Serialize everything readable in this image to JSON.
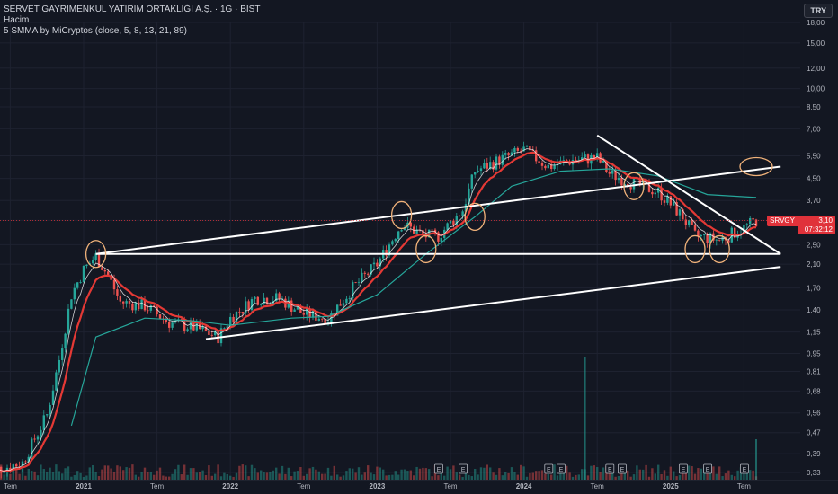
{
  "header": {
    "title": "SERVET GAYRİMENKUL YATIRIM ORTAKLIĞI A.Ş. · 1G · BIST",
    "volume_label": "Hacim",
    "indicator_label": "5 SMMA by MiCryptos (close, 5, 8, 13, 21, 89)",
    "currency_button": "TRY"
  },
  "price_tag": {
    "ticker": "SRVGY",
    "price": "3,10",
    "countdown": "07:32:12"
  },
  "colors": {
    "background": "#131722",
    "up": "#26a69a",
    "down": "#ef5350",
    "smma_fast": "#e53935",
    "smma_slow": "#26a69a",
    "trendline": "#ffffff",
    "circle": "#f0b27a",
    "price_tag": "#e0323a"
  },
  "chart_data": {
    "type": "candlestick",
    "scale": "log",
    "y_ticks": [
      "18,00",
      "15,00",
      "12,00",
      "10,00",
      "8,50",
      "7,00",
      "5,50",
      "4,50",
      "3,70",
      "3,10",
      "2,50",
      "2,10",
      "1,70",
      "1,40",
      "1,15",
      "0,95",
      "0,81",
      "0,68",
      "0,56",
      "0,47",
      "0,39",
      "0,33"
    ],
    "y_tick_values": [
      18,
      15,
      12,
      10,
      8.5,
      7,
      5.5,
      4.5,
      3.7,
      3.1,
      2.5,
      2.1,
      1.7,
      1.4,
      1.15,
      0.95,
      0.81,
      0.68,
      0.56,
      0.47,
      0.39,
      0.33
    ],
    "x_ticks": [
      "Tem",
      "2021",
      "Tem",
      "2022",
      "Tem",
      "2023",
      "Tem",
      "2024",
      "Tem",
      "2025",
      "Tem"
    ],
    "x_tick_dates": [
      "2020-07",
      "2021-01",
      "2021-07",
      "2022-01",
      "2022-07",
      "2023-01",
      "2023-07",
      "2024-01",
      "2024-07",
      "2025-01",
      "2025-07"
    ],
    "price_path": [
      [
        "2020-05",
        0.33
      ],
      [
        "2020-08",
        0.36
      ],
      [
        "2020-10",
        0.55
      ],
      [
        "2020-11",
        0.9
      ],
      [
        "2020-12",
        1.6
      ],
      [
        "2021-01",
        2.0
      ],
      [
        "2021-02",
        2.25
      ],
      [
        "2021-03",
        1.9
      ],
      [
        "2021-04",
        1.5
      ],
      [
        "2021-06",
        1.45
      ],
      [
        "2021-08",
        1.25
      ],
      [
        "2021-10",
        1.2
      ],
      [
        "2021-12",
        1.1
      ],
      [
        "2022-01",
        1.3
      ],
      [
        "2022-03",
        1.55
      ],
      [
        "2022-05",
        1.55
      ],
      [
        "2022-07",
        1.35
      ],
      [
        "2022-09",
        1.3
      ],
      [
        "2022-11",
        1.7
      ],
      [
        "2023-01",
        2.1
      ],
      [
        "2023-03",
        3.0
      ],
      [
        "2023-05",
        2.7
      ],
      [
        "2023-06",
        2.7
      ],
      [
        "2023-08",
        3.4
      ],
      [
        "2023-09",
        4.8
      ],
      [
        "2023-11",
        5.3
      ],
      [
        "2024-01",
        5.8
      ],
      [
        "2024-03",
        5.0
      ],
      [
        "2024-05",
        5.3
      ],
      [
        "2024-07",
        5.4
      ],
      [
        "2024-08",
        4.7
      ],
      [
        "2024-10",
        4.3
      ],
      [
        "2024-12",
        4.0
      ],
      [
        "2025-02",
        3.2
      ],
      [
        "2025-03",
        2.7
      ],
      [
        "2025-05",
        2.6
      ],
      [
        "2025-07",
        2.9
      ],
      [
        "2025-08",
        3.1
      ]
    ],
    "smma_slow_path": [
      [
        "2020-12",
        0.5
      ],
      [
        "2021-02",
        1.1
      ],
      [
        "2021-06",
        1.3
      ],
      [
        "2021-10",
        1.27
      ],
      [
        "2022-01",
        1.22
      ],
      [
        "2022-06",
        1.3
      ],
      [
        "2022-09",
        1.32
      ],
      [
        "2023-01",
        1.6
      ],
      [
        "2023-05",
        2.3
      ],
      [
        "2023-09",
        3.2
      ],
      [
        "2023-12",
        4.2
      ],
      [
        "2024-04",
        4.8
      ],
      [
        "2024-08",
        4.9
      ],
      [
        "2024-12",
        4.6
      ],
      [
        "2025-04",
        3.9
      ],
      [
        "2025-08",
        3.8
      ]
    ],
    "volume_spike_dates": [
      "2024-06",
      "2025-08"
    ],
    "earnings_dates": [
      "2023-06",
      "2023-08",
      "2024-03",
      "2024-04",
      "2024-08",
      "2024-09",
      "2025-02",
      "2025-04",
      "2025-07"
    ],
    "trendlines": [
      [
        [
          "2021-02",
          2.3
        ],
        [
          "2025-10",
          5.0
        ]
      ],
      [
        [
          "2021-02",
          2.3
        ],
        [
          "2025-10",
          2.3
        ]
      ],
      [
        [
          "2021-11",
          1.08
        ],
        [
          "2025-10",
          2.05
        ]
      ],
      [
        [
          "2024-07",
          6.6
        ],
        [
          "2025-10",
          2.3
        ]
      ]
    ],
    "circles": [
      [
        "2021-02",
        2.3
      ],
      [
        "2023-03",
        3.25
      ],
      [
        "2023-05",
        2.4
      ],
      [
        "2023-09",
        3.2
      ],
      [
        "2024-10",
        4.2
      ],
      [
        "2025-03",
        2.4
      ],
      [
        "2025-05",
        2.4
      ],
      [
        "2025-08",
        5.0
      ]
    ]
  }
}
